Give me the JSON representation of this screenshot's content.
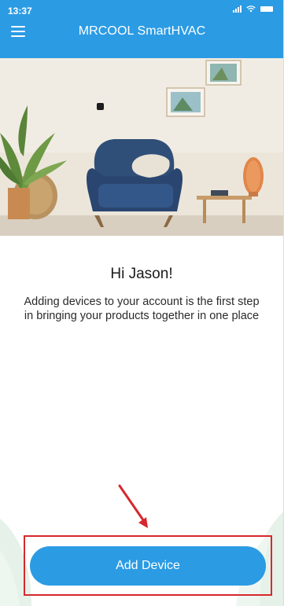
{
  "status_bar": {
    "time": "13:37"
  },
  "header": {
    "title": "MRCOOL SmartHVAC",
    "menu_icon": "hamburger-menu-icon"
  },
  "welcome": {
    "greeting": "Hi Jason!",
    "description": "Adding devices to your account is the first step in bringing your products together in one place"
  },
  "actions": {
    "add_device_label": "Add Device"
  },
  "colors": {
    "brand": "#2b9be4",
    "annotation": "#d6282d",
    "chair": "#2f4f78"
  }
}
